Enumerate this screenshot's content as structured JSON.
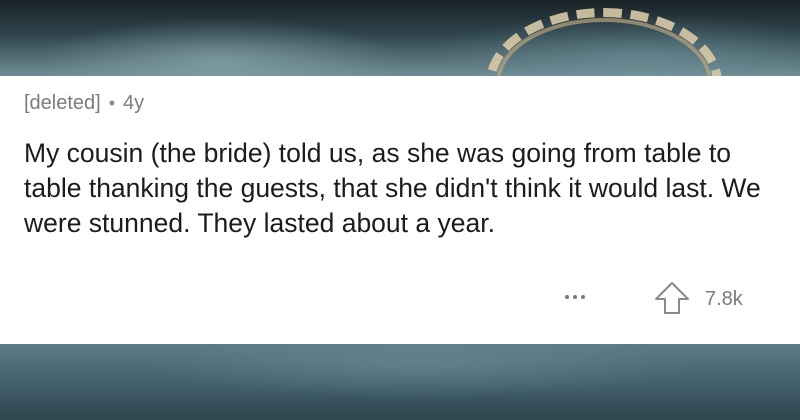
{
  "comment": {
    "author": "[deleted]",
    "separator": "•",
    "age": "4y",
    "body": "My cousin (the bride) told us, as she was going from table to table thanking the guests, that she didn't think it would last. We were stunned. They lasted about a year."
  },
  "actions": {
    "more_icon": "ellipsis-icon",
    "upvote_icon": "upvote-arrow-icon",
    "score": "7.8k"
  },
  "colors": {
    "card_background": "#ffffff",
    "body_text": "#1c1c1c",
    "meta_text": "#7c7c7c"
  }
}
